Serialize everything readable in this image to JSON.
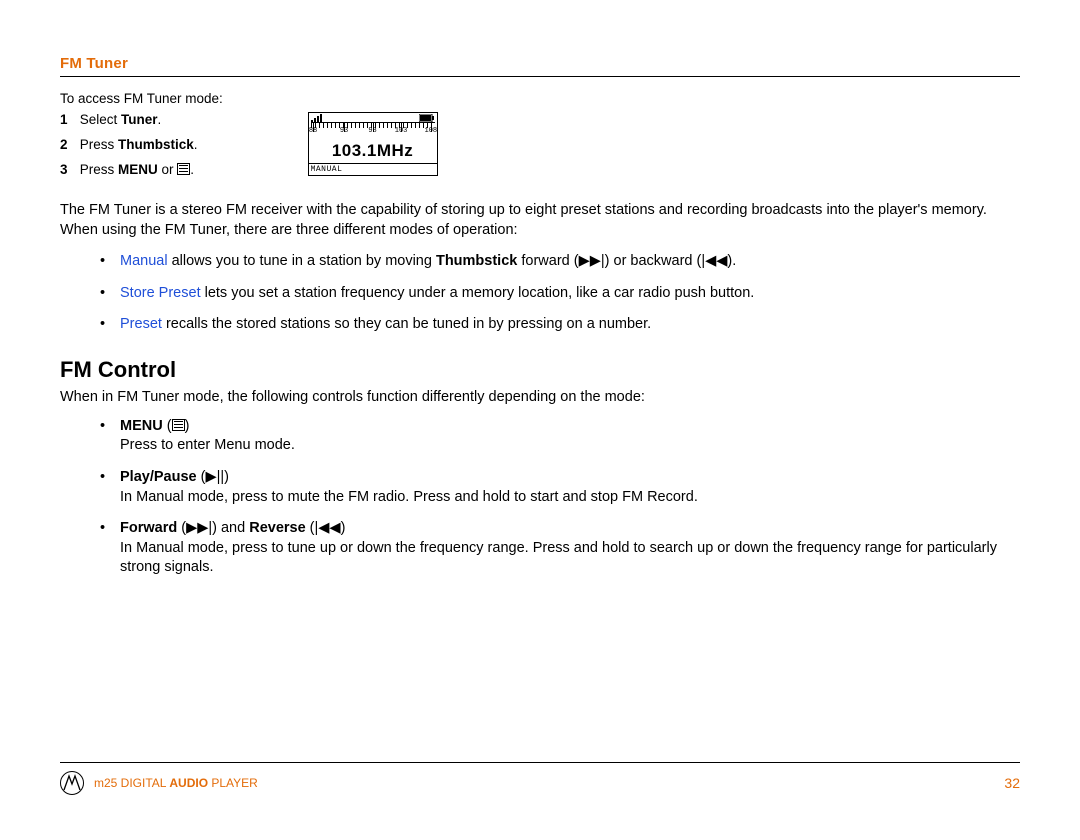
{
  "heading": "FM Tuner",
  "access_line": "To access FM Tuner mode:",
  "steps": [
    {
      "pre": "Select ",
      "bold": "Tuner",
      "post": "."
    },
    {
      "pre": "Press ",
      "bold": "Thumbstick",
      "post": "."
    },
    {
      "pre": "Press ",
      "bold": "MENU",
      "post": " or "
    }
  ],
  "lcd": {
    "ticks": [
      {
        "pos": 2,
        "label": "88"
      },
      {
        "pos": 27,
        "label": "93"
      },
      {
        "pos": 50,
        "label": "98"
      },
      {
        "pos": 73,
        "label": "103"
      },
      {
        "pos": 97,
        "label": "108"
      }
    ],
    "freq": "103.1MHz",
    "mode": "MANUAL"
  },
  "intro_para": "The FM Tuner is a stereo FM receiver with the capability of storing up to eight preset stations and recording broadcasts into the player's memory. When using the FM Tuner, there are three different modes of operation:",
  "modes": [
    {
      "name": "Manual",
      "text_a": " allows you to tune in a station by moving ",
      "bold": "Thumbstick",
      "text_b": " forward (▶▶|) or backward (|◀◀)."
    },
    {
      "name": "Store Preset",
      "text_a": " lets you set a station frequency under a memory location, like a car radio push button.",
      "bold": "",
      "text_b": ""
    },
    {
      "name": "Preset",
      "text_a": " recalls the stored stations so they can be tuned in by pressing on a number.",
      "bold": "",
      "text_b": ""
    }
  ],
  "fm_control_heading": "FM Control",
  "fm_control_intro": "When in FM Tuner mode, the following controls function differently depending on the mode:",
  "controls": [
    {
      "label": "MENU",
      "glyph_html": "menu",
      "desc": "Press to enter Menu mode."
    },
    {
      "label": "Play/Pause",
      "glyph_html": "playpause",
      "desc": "In Manual mode, press to mute the FM radio. Press and hold to start and stop FM Record."
    },
    {
      "label": "Forward",
      "glyph_html": "fwdrev",
      "desc": "In Manual mode, press to tune up or down the frequency range. Press and hold to search up or down the frequency range for particularly strong signals."
    }
  ],
  "fwd_rev": {
    "mid": " and ",
    "label2": "Reverse"
  },
  "footer": {
    "p1": "m25 DIGITAL ",
    "p2": "AUDIO",
    "p3": " PLAYER",
    "page": "32"
  }
}
